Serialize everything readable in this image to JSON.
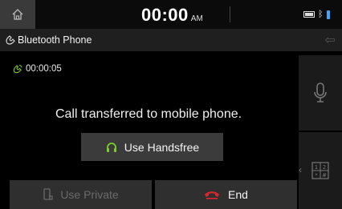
{
  "status_bar": {
    "time": "00:00",
    "ampm": "AM",
    "icons": [
      "home-icon",
      "battery-icon",
      "bluetooth-icon",
      "signal-icon"
    ]
  },
  "header": {
    "title": "Bluetooth Phone",
    "icons": [
      "phone-icon",
      "back-icon"
    ]
  },
  "call": {
    "timer": "00:00:05",
    "message": "Call transferred to mobile phone.",
    "handsfree_label": "Use Handsfree"
  },
  "side_panel": {
    "icons": [
      "microphone-icon",
      "keypad-icon",
      "chevron-left-icon"
    ]
  },
  "bottom_bar": {
    "private_label": "Use Private",
    "end_label": "End"
  },
  "colors": {
    "accent_green": "#7ccf2a",
    "end_red": "#e0262b",
    "button_gray": "#3b3b3b"
  }
}
